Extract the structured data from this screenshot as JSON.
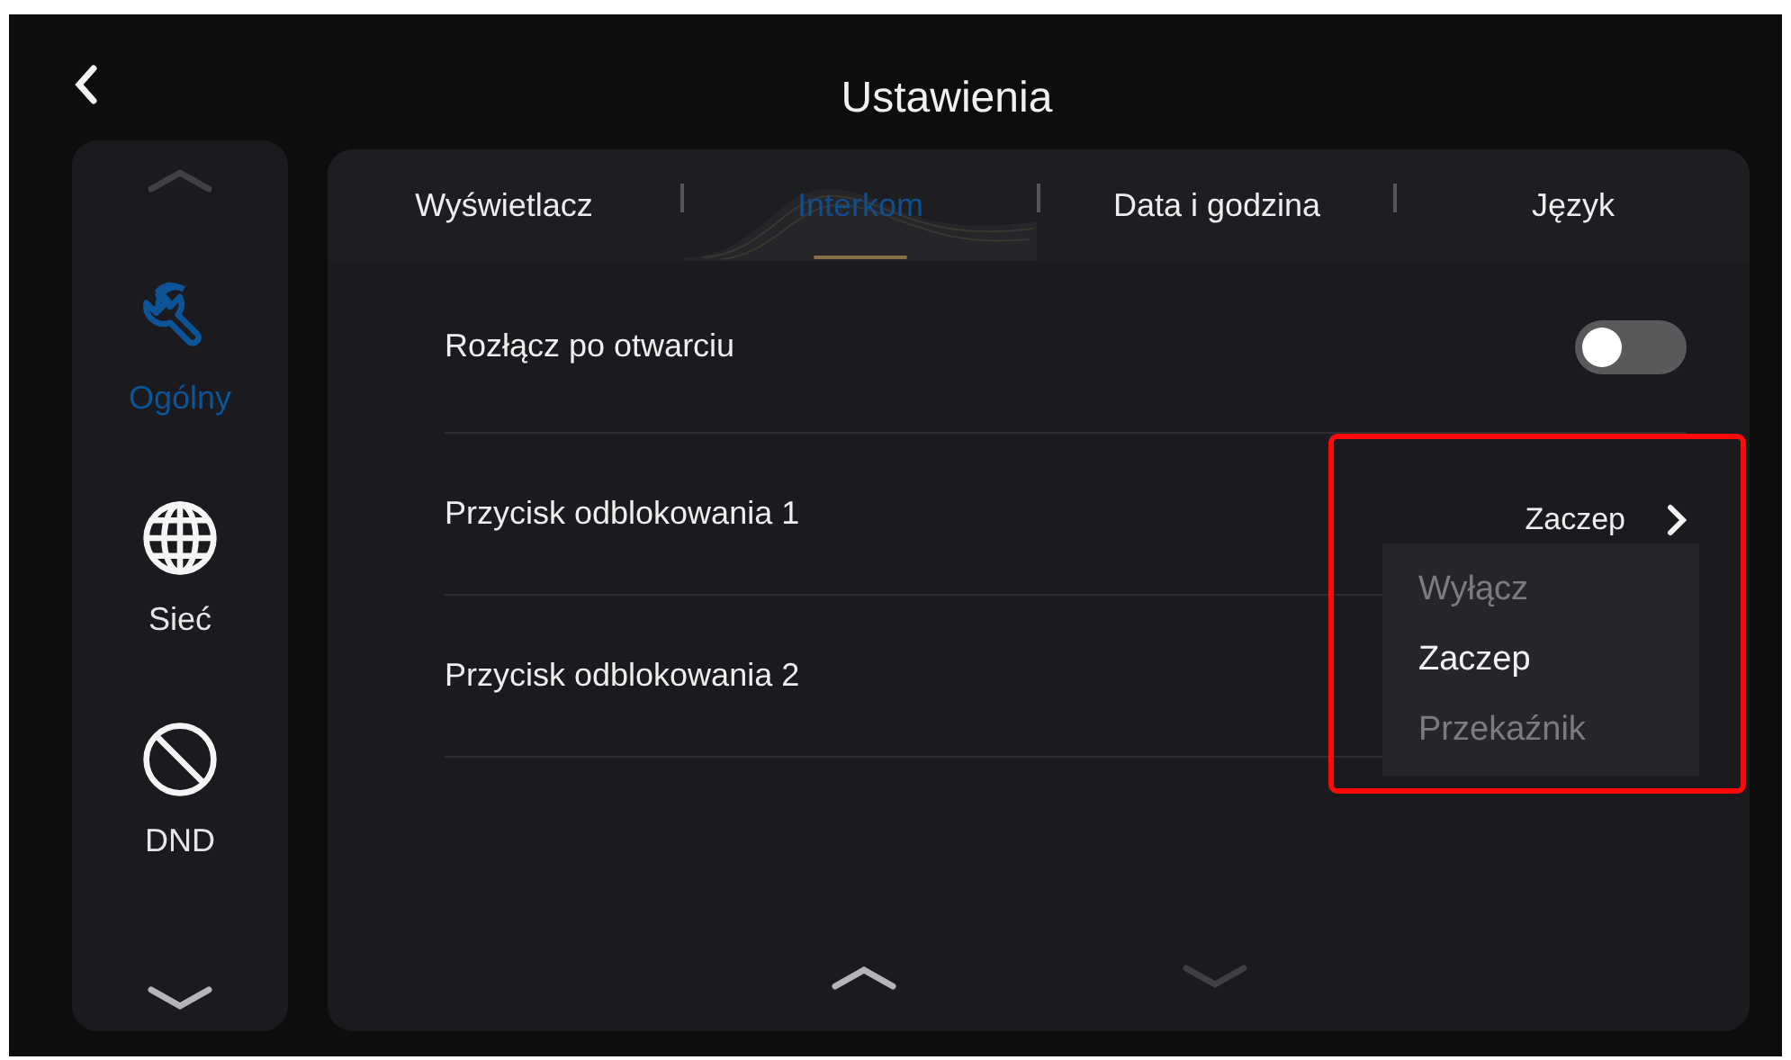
{
  "header": {
    "title": "Ustawienia"
  },
  "sidebar": {
    "can_scroll_up": false,
    "can_scroll_down": true,
    "items": [
      {
        "kind": "wrench",
        "label": "Ogólny",
        "selected": true
      },
      {
        "kind": "globe",
        "label": "Sieć",
        "selected": false
      },
      {
        "kind": "block",
        "label": "DND",
        "selected": false
      }
    ]
  },
  "tabs": [
    {
      "label": "Wyświetlacz",
      "selected": false
    },
    {
      "label": "Interkom",
      "selected": true
    },
    {
      "label": "Data i godzina",
      "selected": false
    },
    {
      "label": "Język",
      "selected": false
    }
  ],
  "settings": [
    {
      "kind": "toggle",
      "label": "Rozłącz po otwarciu",
      "on": false
    },
    {
      "kind": "select",
      "label": "Przycisk odblokowania 1",
      "value": "Zaczep",
      "expanded": true,
      "options": [
        {
          "label": "Wyłącz",
          "selected": false
        },
        {
          "label": "Zaczep",
          "selected": true
        },
        {
          "label": "Przekaźnik",
          "selected": false
        }
      ]
    },
    {
      "kind": "select",
      "label": "Przycisk odblokowania 2"
    }
  ],
  "list_scroll": {
    "can_scroll_up": true,
    "can_scroll_down": false
  },
  "annotation": {
    "highlight": true
  }
}
